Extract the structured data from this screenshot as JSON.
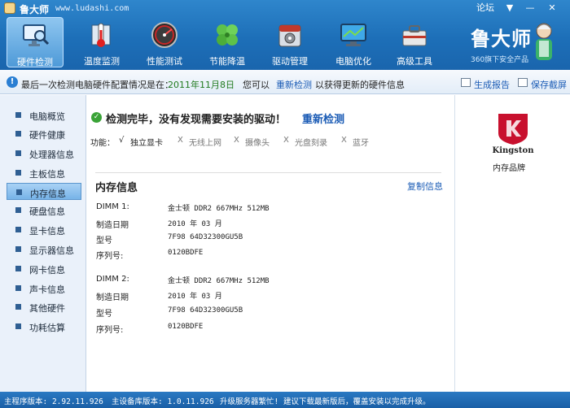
{
  "window": {
    "app_name": "鲁大师",
    "url": "www.ludashi.com",
    "forum_label": "论坛",
    "menu_glyph": "▼",
    "min_glyph": "—",
    "close_glyph": "✕"
  },
  "toolbar": {
    "items": [
      {
        "label": "硬件检测",
        "icon": "monitor-magnifier-icon"
      },
      {
        "label": "温度监测",
        "icon": "thermometer-icon"
      },
      {
        "label": "性能测试",
        "icon": "speedometer-icon"
      },
      {
        "label": "节能降温",
        "icon": "clover-icon"
      },
      {
        "label": "驱动管理",
        "icon": "driver-box-icon"
      },
      {
        "label": "电脑优化",
        "icon": "monitor-optimize-icon"
      },
      {
        "label": "高级工具",
        "icon": "toolbox-icon"
      }
    ],
    "active_index": 0
  },
  "brand": {
    "name": "鲁大师",
    "sub": "360旗下安全产品"
  },
  "status_row": {
    "last_scan": "最后一次检测电脑硬件配置情况是在：",
    "date": "2011年11月8日",
    "you_can": "您可以",
    "rescan": "重新检测",
    "tail": "以获得更新的硬件信息",
    "report": "生成报告",
    "screenshot": "保存截屏"
  },
  "sidebar": {
    "items": [
      {
        "label": "电脑概览"
      },
      {
        "label": "硬件健康"
      },
      {
        "label": "处理器信息"
      },
      {
        "label": "主板信息"
      },
      {
        "label": "内存信息"
      },
      {
        "label": "硬盘信息"
      },
      {
        "label": "显卡信息"
      },
      {
        "label": "显示器信息"
      },
      {
        "label": "网卡信息"
      },
      {
        "label": "声卡信息"
      },
      {
        "label": "其他硬件"
      },
      {
        "label": "功耗估算"
      }
    ],
    "active_index": 4
  },
  "main": {
    "headline": "检测完毕，没有发现需要安装的驱动！",
    "rescan_link": "重新检测",
    "features_label": "功能：",
    "features": [
      {
        "mark": "√",
        "name": "独立显卡",
        "on": true
      },
      {
        "mark": "X",
        "name": "无线上网",
        "on": false
      },
      {
        "mark": "X",
        "name": "摄像头",
        "on": false
      },
      {
        "mark": "X",
        "name": "光盘刻录",
        "on": false
      },
      {
        "mark": "X",
        "name": "蓝牙",
        "on": false
      }
    ],
    "memory_title": "内存信息",
    "copy_link": "复制信息",
    "dimms": [
      {
        "slot_label": "DIMM 1:",
        "model": "金士顿 DDR2 667MHz 512MB",
        "date_label": "制造日期",
        "date": "2010 年 03 月",
        "type_label": "型号",
        "type": "7F98 64D32300GU5B",
        "serial_label": "序列号:",
        "serial": "0120BDFE"
      },
      {
        "slot_label": "DIMM 2:",
        "model": "金士顿 DDR2 667MHz 512MB",
        "date_label": "制造日期",
        "date": "2010 年 03 月",
        "type_label": "型号",
        "type": "7F98 64D32300GU5B",
        "serial_label": "序列号:",
        "serial": "0120BDFE"
      }
    ]
  },
  "right": {
    "logo_text": "Kingston",
    "caption": "内存品牌"
  },
  "bottom": {
    "program_version": "主程序版本: 2.92.11.926",
    "device_version": "主设备库版本: 1.0.11.926",
    "warning": "升级服务器繁忙! 建议下载最新版后，覆盖安装以完成升级。"
  },
  "colors": {
    "toolbar_blue": "#1d6fb8",
    "link_blue": "#1a5bb5",
    "date_green": "#207a1f",
    "ok_green": "#3aa337",
    "kingston_red": "#c8102e"
  }
}
